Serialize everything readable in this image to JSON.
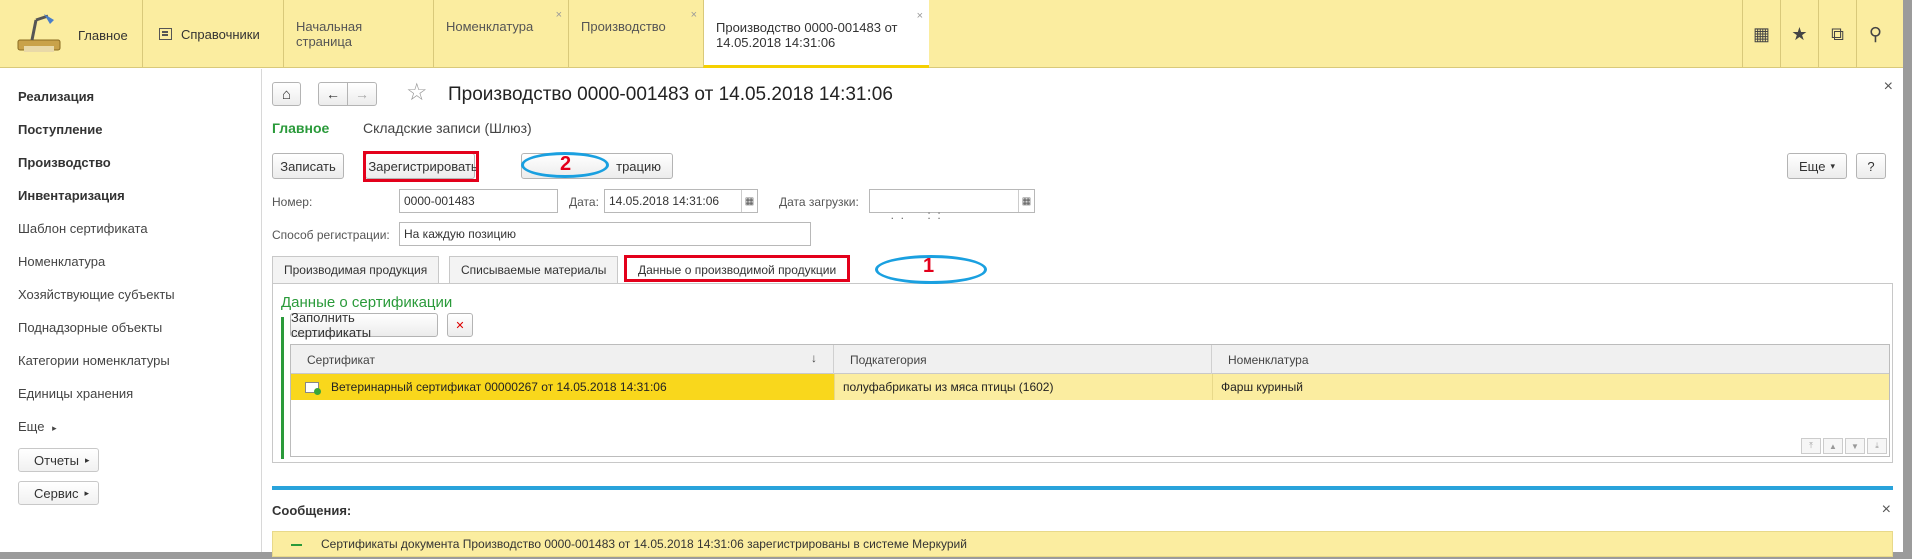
{
  "topbar": {
    "main_label": "Главное",
    "reference_label": "Справочники",
    "tabs": [
      {
        "label": "Начальная страница",
        "closable": false
      },
      {
        "label": "Номенклатура",
        "closable": true
      },
      {
        "label": "Производство",
        "closable": true
      },
      {
        "label": "Производство 0000-001483 от 14.05.2018 14:31:06",
        "line1": "Производство 0000-001483 от",
        "line2": "14.05.2018 14:31:06",
        "closable": true,
        "active": true
      }
    ],
    "close_glyph": "×",
    "icons": [
      "grid-icon",
      "star-icon",
      "history-icon",
      "search-icon"
    ],
    "icon_glyphs": [
      "▦",
      "★",
      "⧉",
      "⚲"
    ]
  },
  "sidebar": {
    "items": [
      {
        "label": "Реализация",
        "bold": true
      },
      {
        "label": "Поступление",
        "bold": true
      },
      {
        "label": "Производство",
        "bold": true
      },
      {
        "label": "Инвентаризация",
        "bold": true
      },
      {
        "label": "Шаблон сертификата",
        "bold": false
      },
      {
        "label": "Номенклатура",
        "bold": false
      },
      {
        "label": "Хозяйствующие субъекты",
        "bold": false
      },
      {
        "label": "Поднадзорные объекты",
        "bold": false
      },
      {
        "label": "Категории номенклатуры",
        "bold": false
      },
      {
        "label": "Единицы хранения",
        "bold": false
      },
      {
        "label": "Еще",
        "bold": false
      }
    ],
    "more_arrow": "▸",
    "reports_label": "Отчеты",
    "service_label": "Сервис"
  },
  "form": {
    "title": "Производство 0000-001483 от 14.05.2018 14:31:06",
    "close_glyph": "×",
    "nav_home_glyph": "⌂",
    "nav_back_glyph": "←",
    "nav_fwd_glyph": "→",
    "fav_glyph": "☆",
    "section_main": "Главное",
    "section_log": "Складские записи (Шлюз)",
    "buttons": {
      "write": "Записать",
      "register": "Зарегистрировать",
      "cancel_reg_visible": "трацию",
      "more": "Еще",
      "more_arrow": "▾",
      "help": "?"
    },
    "fields": {
      "number_label": "Номер:",
      "number_value": "0000-001483",
      "date_label": "Дата:",
      "date_value": "14.05.2018 14:31:06",
      "load_date_label": "Дата загрузки:",
      "load_date_value": " .  .       :  :",
      "reg_method_label": "Способ регистрации:",
      "reg_method_value": "На каждую позицию"
    },
    "tabs": [
      {
        "label": "Производимая продукция",
        "active": false
      },
      {
        "label": "Списываемые материалы",
        "active": false
      },
      {
        "label": "Данные о производимой продукции",
        "active": true
      }
    ],
    "group_title": "Данные о сертификации",
    "fill_button": "Заполнить сертификаты",
    "delete_glyph": "✕",
    "grid": {
      "columns": [
        "Сертификат",
        "Подкатегория",
        "Номенклатура"
      ],
      "sort_glyph": "↓",
      "rows": [
        {
          "certificate": "Ветеринарный сертификат 00000267 от 14.05.2018 14:31:06",
          "subcategory": "полуфабрикаты из мяса птицы (1602)",
          "nomenclature": "Фарш куриный"
        }
      ],
      "scroll_glyphs": [
        "⤒",
        "▲",
        "▼",
        "⤓"
      ]
    }
  },
  "messages": {
    "title": "Сообщения:",
    "close_glyph": "×",
    "items": [
      "Сертификаты документа Производство 0000-001483 от 14.05.2018 14:31:06 зарегистрированы в системе Меркурий"
    ]
  },
  "annotations": {
    "label_1": "1",
    "label_2": "2",
    "box_color": "#e3001b",
    "ellipse_color": "#1aa0e0"
  },
  "colors": {
    "topbar_bg": "#fbeda0",
    "accent_green": "#2a9a3a",
    "selected_row": "#f9d71c",
    "messages_bar": "#29a3db"
  }
}
